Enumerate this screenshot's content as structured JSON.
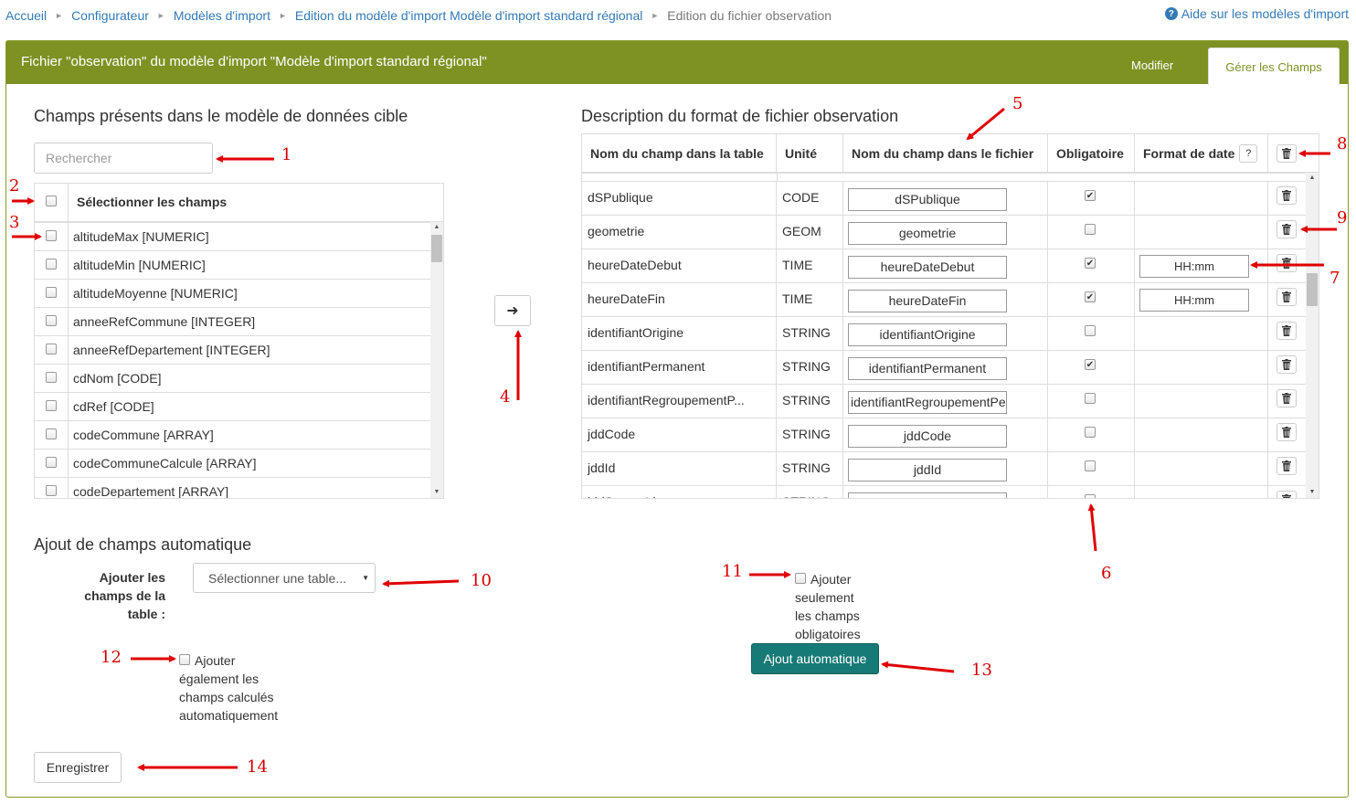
{
  "breadcrumb": {
    "items": [
      "Accueil",
      "Configurateur",
      "Modèles d'import",
      "Edition du modèle d'import Modèle d'import standard régional"
    ],
    "current": "Edition du fichier observation"
  },
  "help": {
    "label": "Aide sur les modèles d'import",
    "icon": "question-circle-icon"
  },
  "panel": {
    "title": "Fichier \"observation\" du modèle d'import \"Modèle d'import standard régional\"",
    "tabs": [
      "Modifier",
      "Gérer les Champs"
    ],
    "active_tab": "Gérer les Champs",
    "header_color": "#7d9223"
  },
  "left": {
    "title": "Champs présents dans le modèle de données cible",
    "search_placeholder": "Rechercher",
    "select_all_label": "Sélectionner les champs",
    "fields": [
      "altitudeMax [NUMERIC]",
      "altitudeMin [NUMERIC]",
      "altitudeMoyenne [NUMERIC]",
      "anneeRefCommune [INTEGER]",
      "anneeRefDepartement [INTEGER]",
      "cdNom [CODE]",
      "cdRef [CODE]",
      "codeCommune [ARRAY]",
      "codeCommuneCalcule [ARRAY]",
      "codeDepartement [ARRAY]"
    ]
  },
  "transfer_button": {
    "icon": "arrow-right-icon"
  },
  "right": {
    "title": "Description du format de fichier observation",
    "columns": [
      "Nom du champ dans la table",
      "Unité",
      "Nom du champ dans le fichier",
      "Obligatoire",
      "Format de date"
    ],
    "help_button": "?",
    "rows": [
      {
        "name": "dSPublique",
        "unit": "CODE",
        "file_name": "dSPublique",
        "required": true,
        "date_format": ""
      },
      {
        "name": "geometrie",
        "unit": "GEOM",
        "file_name": "geometrie",
        "required": false,
        "date_format": ""
      },
      {
        "name": "heureDateDebut",
        "unit": "TIME",
        "file_name": "heureDateDebut",
        "required": true,
        "date_format": "HH:mm"
      },
      {
        "name": "heureDateFin",
        "unit": "TIME",
        "file_name": "heureDateFin",
        "required": true,
        "date_format": "HH:mm"
      },
      {
        "name": "identifiantOrigine",
        "unit": "STRING",
        "file_name": "identifiantOrigine",
        "required": false,
        "date_format": ""
      },
      {
        "name": "identifiantPermanent",
        "unit": "STRING",
        "file_name": "identifiantPermanent",
        "required": true,
        "date_format": ""
      },
      {
        "name": "identifiantRegroupementP...",
        "unit": "STRING",
        "file_name": "identifiantRegroupementPe",
        "required": false,
        "date_format": ""
      },
      {
        "name": "jddCode",
        "unit": "STRING",
        "file_name": "jddCode",
        "required": false,
        "date_format": ""
      },
      {
        "name": "jddId",
        "unit": "STRING",
        "file_name": "jddId",
        "required": false,
        "date_format": ""
      },
      {
        "name": "jddSourceId",
        "unit": "STRING",
        "file_name": "jddSourceId",
        "required": false,
        "date_format": ""
      }
    ]
  },
  "auto": {
    "title": "Ajout de champs automatique",
    "add_label": "Ajouter les champs de la table :",
    "select_placeholder": "Sélectionner une table...",
    "option_calc": "Ajouter également les champs calculés automatiquement",
    "option_required": "Ajouter seulement les champs obligatoires",
    "button": "Ajout automatique",
    "button_color": "#167a76"
  },
  "save_button": "Enregistrer",
  "annotations": {
    "color": "#d40000",
    "labels": [
      "1",
      "2",
      "3",
      "4",
      "5",
      "6",
      "7",
      "8",
      "9",
      "10",
      "11",
      "12",
      "13",
      "14"
    ]
  }
}
